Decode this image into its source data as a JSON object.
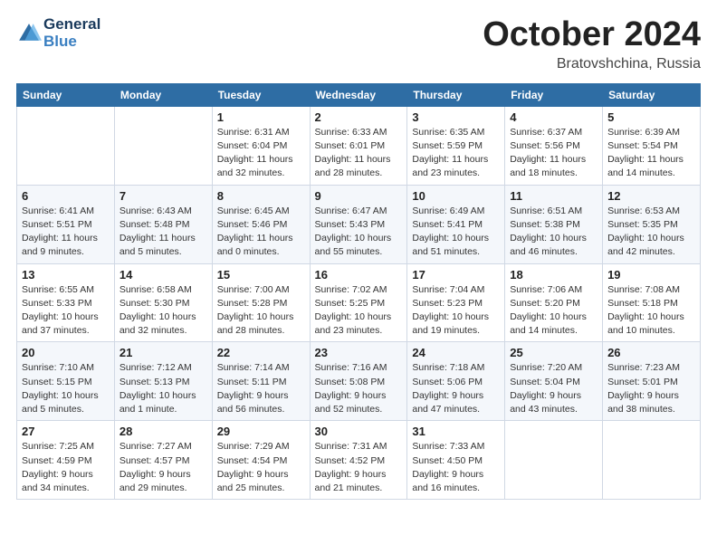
{
  "header": {
    "logo_line1": "General",
    "logo_line2": "Blue",
    "month": "October 2024",
    "location": "Bratovshchina, Russia"
  },
  "weekdays": [
    "Sunday",
    "Monday",
    "Tuesday",
    "Wednesday",
    "Thursday",
    "Friday",
    "Saturday"
  ],
  "weeks": [
    [
      {
        "day": "",
        "info": ""
      },
      {
        "day": "",
        "info": ""
      },
      {
        "day": "1",
        "info": "Sunrise: 6:31 AM\nSunset: 6:04 PM\nDaylight: 11 hours\nand 32 minutes."
      },
      {
        "day": "2",
        "info": "Sunrise: 6:33 AM\nSunset: 6:01 PM\nDaylight: 11 hours\nand 28 minutes."
      },
      {
        "day": "3",
        "info": "Sunrise: 6:35 AM\nSunset: 5:59 PM\nDaylight: 11 hours\nand 23 minutes."
      },
      {
        "day": "4",
        "info": "Sunrise: 6:37 AM\nSunset: 5:56 PM\nDaylight: 11 hours\nand 18 minutes."
      },
      {
        "day": "5",
        "info": "Sunrise: 6:39 AM\nSunset: 5:54 PM\nDaylight: 11 hours\nand 14 minutes."
      }
    ],
    [
      {
        "day": "6",
        "info": "Sunrise: 6:41 AM\nSunset: 5:51 PM\nDaylight: 11 hours\nand 9 minutes."
      },
      {
        "day": "7",
        "info": "Sunrise: 6:43 AM\nSunset: 5:48 PM\nDaylight: 11 hours\nand 5 minutes."
      },
      {
        "day": "8",
        "info": "Sunrise: 6:45 AM\nSunset: 5:46 PM\nDaylight: 11 hours\nand 0 minutes."
      },
      {
        "day": "9",
        "info": "Sunrise: 6:47 AM\nSunset: 5:43 PM\nDaylight: 10 hours\nand 55 minutes."
      },
      {
        "day": "10",
        "info": "Sunrise: 6:49 AM\nSunset: 5:41 PM\nDaylight: 10 hours\nand 51 minutes."
      },
      {
        "day": "11",
        "info": "Sunrise: 6:51 AM\nSunset: 5:38 PM\nDaylight: 10 hours\nand 46 minutes."
      },
      {
        "day": "12",
        "info": "Sunrise: 6:53 AM\nSunset: 5:35 PM\nDaylight: 10 hours\nand 42 minutes."
      }
    ],
    [
      {
        "day": "13",
        "info": "Sunrise: 6:55 AM\nSunset: 5:33 PM\nDaylight: 10 hours\nand 37 minutes."
      },
      {
        "day": "14",
        "info": "Sunrise: 6:58 AM\nSunset: 5:30 PM\nDaylight: 10 hours\nand 32 minutes."
      },
      {
        "day": "15",
        "info": "Sunrise: 7:00 AM\nSunset: 5:28 PM\nDaylight: 10 hours\nand 28 minutes."
      },
      {
        "day": "16",
        "info": "Sunrise: 7:02 AM\nSunset: 5:25 PM\nDaylight: 10 hours\nand 23 minutes."
      },
      {
        "day": "17",
        "info": "Sunrise: 7:04 AM\nSunset: 5:23 PM\nDaylight: 10 hours\nand 19 minutes."
      },
      {
        "day": "18",
        "info": "Sunrise: 7:06 AM\nSunset: 5:20 PM\nDaylight: 10 hours\nand 14 minutes."
      },
      {
        "day": "19",
        "info": "Sunrise: 7:08 AM\nSunset: 5:18 PM\nDaylight: 10 hours\nand 10 minutes."
      }
    ],
    [
      {
        "day": "20",
        "info": "Sunrise: 7:10 AM\nSunset: 5:15 PM\nDaylight: 10 hours\nand 5 minutes."
      },
      {
        "day": "21",
        "info": "Sunrise: 7:12 AM\nSunset: 5:13 PM\nDaylight: 10 hours\nand 1 minute."
      },
      {
        "day": "22",
        "info": "Sunrise: 7:14 AM\nSunset: 5:11 PM\nDaylight: 9 hours\nand 56 minutes."
      },
      {
        "day": "23",
        "info": "Sunrise: 7:16 AM\nSunset: 5:08 PM\nDaylight: 9 hours\nand 52 minutes."
      },
      {
        "day": "24",
        "info": "Sunrise: 7:18 AM\nSunset: 5:06 PM\nDaylight: 9 hours\nand 47 minutes."
      },
      {
        "day": "25",
        "info": "Sunrise: 7:20 AM\nSunset: 5:04 PM\nDaylight: 9 hours\nand 43 minutes."
      },
      {
        "day": "26",
        "info": "Sunrise: 7:23 AM\nSunset: 5:01 PM\nDaylight: 9 hours\nand 38 minutes."
      }
    ],
    [
      {
        "day": "27",
        "info": "Sunrise: 7:25 AM\nSunset: 4:59 PM\nDaylight: 9 hours\nand 34 minutes."
      },
      {
        "day": "28",
        "info": "Sunrise: 7:27 AM\nSunset: 4:57 PM\nDaylight: 9 hours\nand 29 minutes."
      },
      {
        "day": "29",
        "info": "Sunrise: 7:29 AM\nSunset: 4:54 PM\nDaylight: 9 hours\nand 25 minutes."
      },
      {
        "day": "30",
        "info": "Sunrise: 7:31 AM\nSunset: 4:52 PM\nDaylight: 9 hours\nand 21 minutes."
      },
      {
        "day": "31",
        "info": "Sunrise: 7:33 AM\nSunset: 4:50 PM\nDaylight: 9 hours\nand 16 minutes."
      },
      {
        "day": "",
        "info": ""
      },
      {
        "day": "",
        "info": ""
      }
    ]
  ]
}
